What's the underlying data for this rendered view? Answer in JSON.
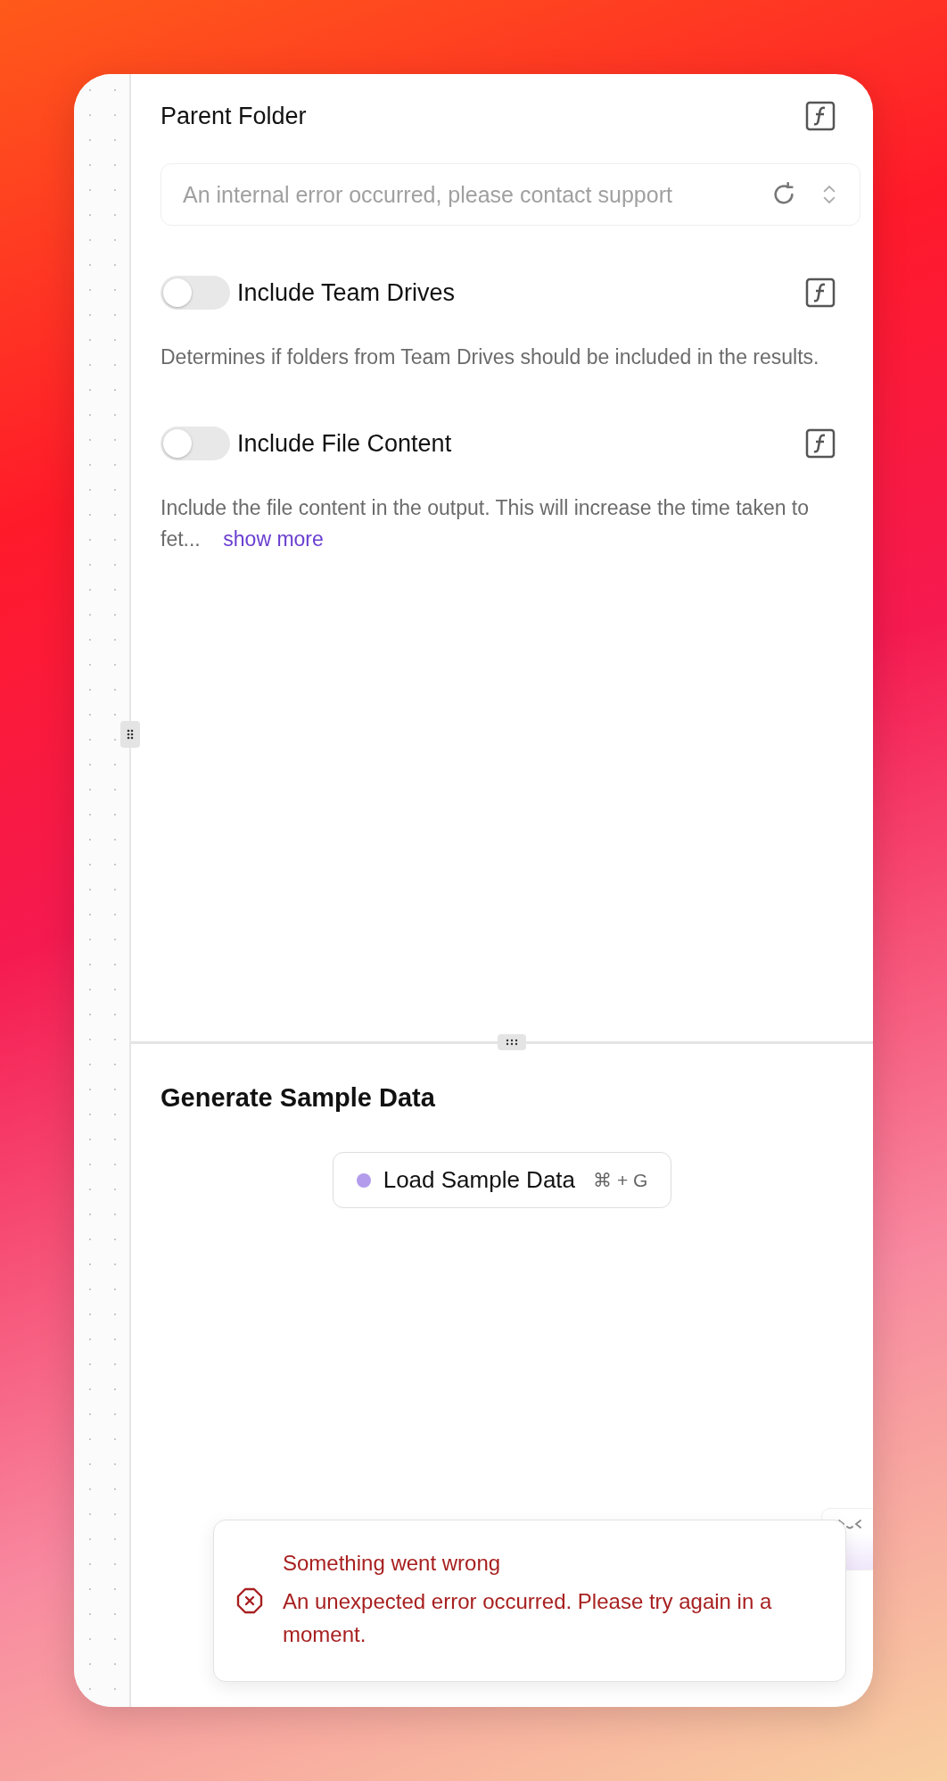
{
  "parent_folder": {
    "label": "Parent Folder",
    "placeholder": "An internal error occurred, please contact support"
  },
  "toggles": [
    {
      "label": "Include Team Drives",
      "on": false,
      "description": "Determines if folders from Team Drives should be included in the results."
    },
    {
      "label": "Include File Content",
      "on": false,
      "description": "Include the file content in the output. This will increase the time taken to fet...",
      "link": "show more"
    }
  ],
  "sample": {
    "title": "Generate Sample Data",
    "button": {
      "label": "Load Sample Data",
      "color": "#b39ceb",
      "shortcut": "⌘ + G"
    }
  },
  "toast": {
    "title": "Something went wrong",
    "message": "An unexpected error occurred. Please try again in a moment."
  }
}
